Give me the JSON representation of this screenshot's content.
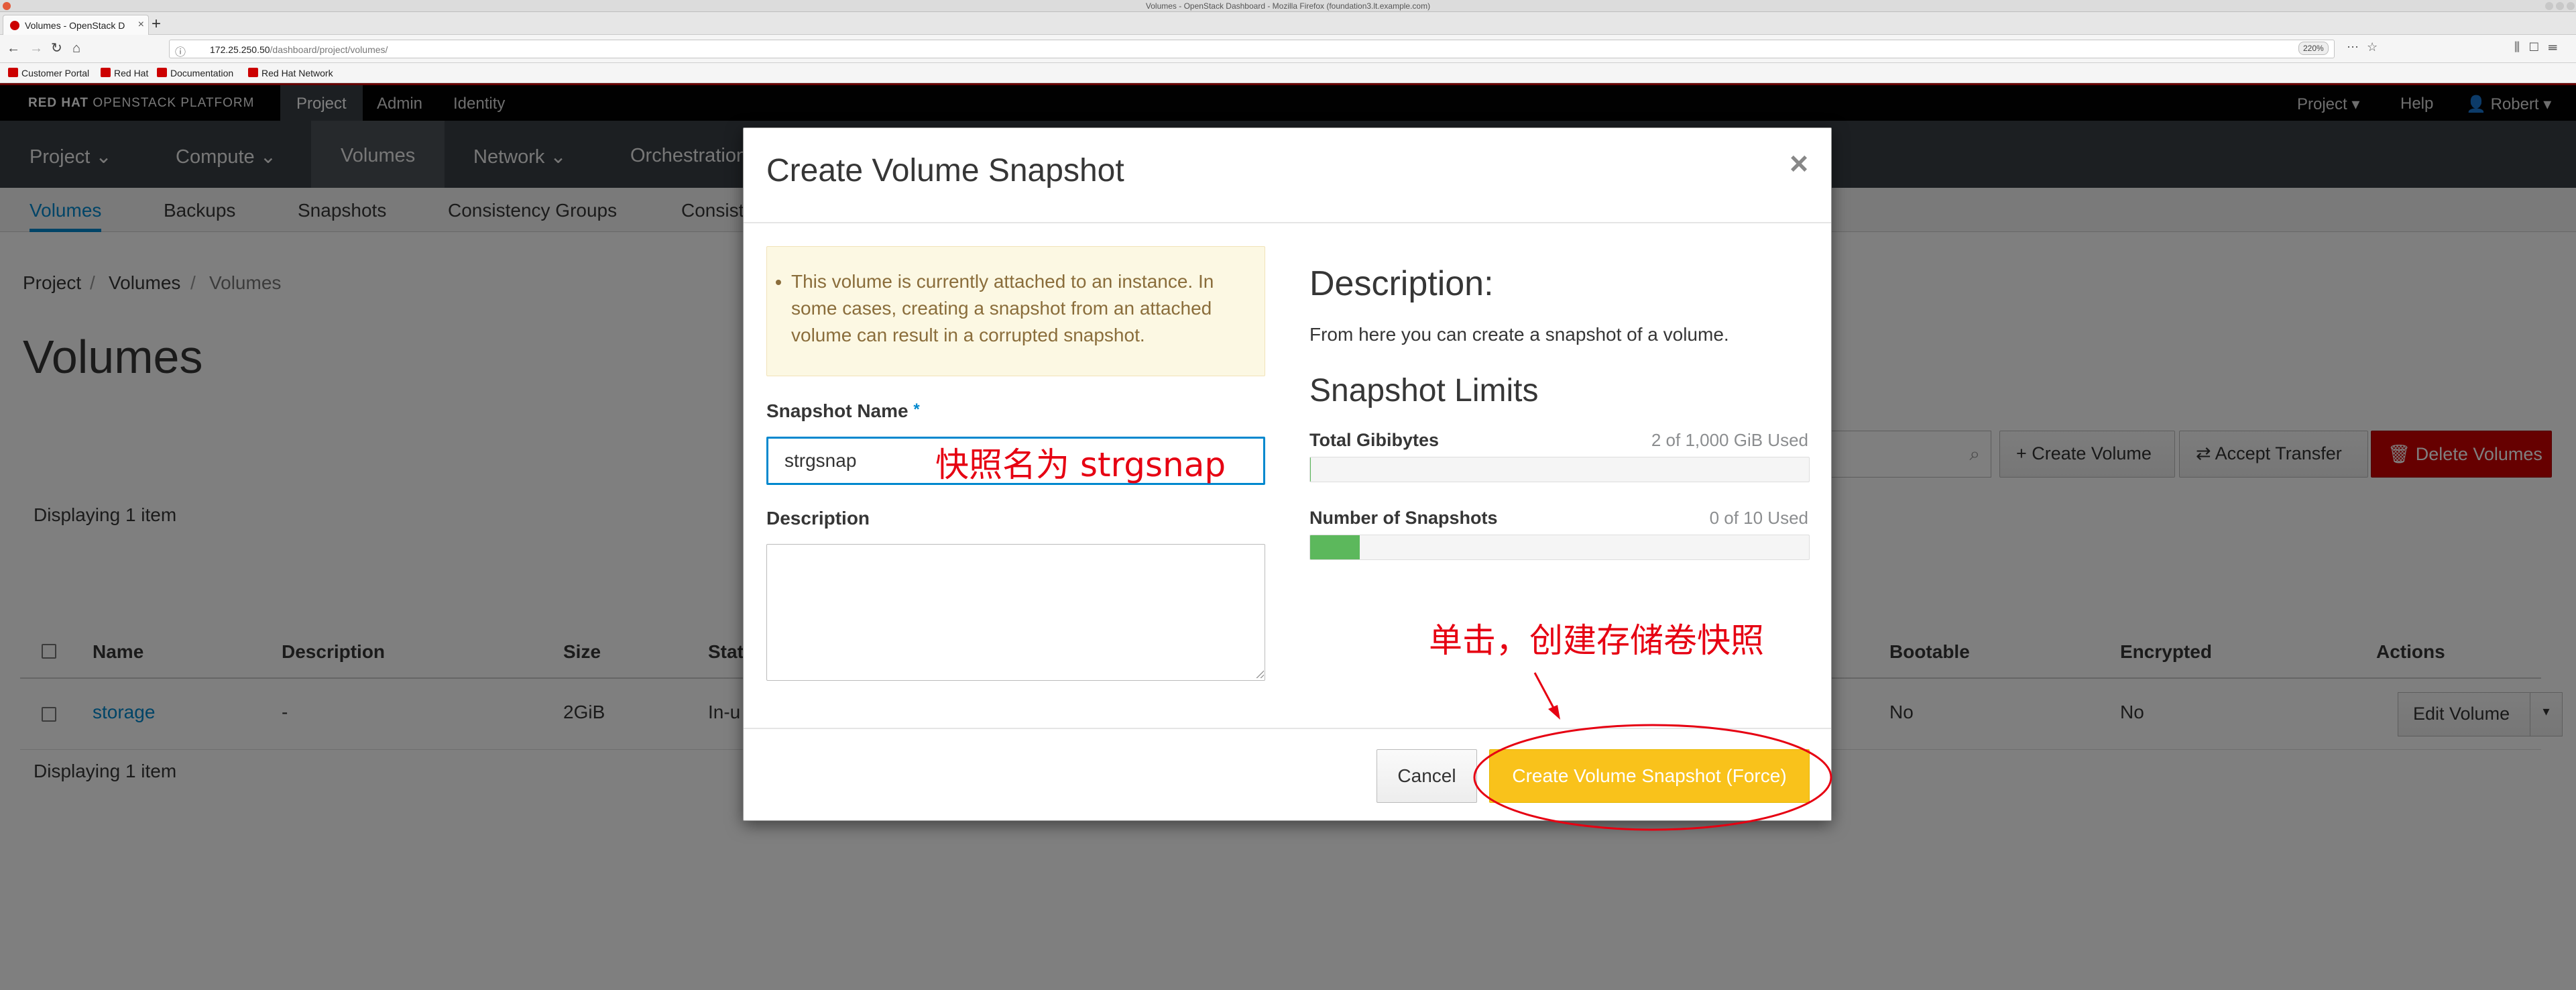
{
  "browser": {
    "window_title": "Volumes - OpenStack Dashboard - Mozilla Firefox (foundation3.lt.example.com)",
    "tab_title": "Volumes - OpenStack D",
    "url_host": "172.25.250.50",
    "url_path": "/dashboard/project/volumes/",
    "zoom": "220%",
    "bookmarks": [
      "Customer Portal",
      "Red Hat",
      "Documentation",
      "Red Hat Network"
    ]
  },
  "topbar": {
    "brand_bold": "RED HAT",
    "brand_rest": " OPENSTACK PLATFORM",
    "nav": [
      "Project",
      "Admin",
      "Identity"
    ],
    "right": {
      "project": "Project",
      "help": "Help",
      "user": "Robert"
    }
  },
  "mainnav": [
    "Project",
    "Compute",
    "Volumes",
    "Network",
    "Orchestration"
  ],
  "subnav": [
    "Volumes",
    "Backups",
    "Snapshots",
    "Consistency Groups",
    "Consist"
  ],
  "breadcrumb": [
    "Project",
    "Volumes",
    "Volumes"
  ],
  "page_title": "Volumes",
  "actions": {
    "create": "Create Volume",
    "accept": "Accept Transfer",
    "delete": "Delete Volumes"
  },
  "table": {
    "count_text": "Displaying 1 item",
    "headers": [
      "Name",
      "Description",
      "Size",
      "Stat",
      "Bootable",
      "Encrypted",
      "Actions"
    ],
    "rows": [
      {
        "name": "storage",
        "description": "-",
        "size": "2GiB",
        "status": "In-u",
        "bootable": "No",
        "encrypted": "No",
        "action": "Edit Volume"
      }
    ]
  },
  "modal": {
    "title": "Create Volume Snapshot",
    "close": "×",
    "warning": "This volume is currently attached to an instance. In some cases, creating a snapshot from an attached volume can result in a corrupted snapshot.",
    "name_label": "Snapshot Name",
    "required_mark": "*",
    "name_value": "strgsnap",
    "desc_label": "Description",
    "right_title": "Description:",
    "right_text": "From here you can create a snapshot of a volume.",
    "limits_title": "Snapshot Limits",
    "limits": [
      {
        "label": "Total Gibibytes",
        "used_text": "2 of 1,000 GiB Used",
        "fraction": 0.002
      },
      {
        "label": "Number of Snapshots",
        "used_text": "0 of 10 Used",
        "fraction": 0.1
      }
    ],
    "cancel": "Cancel",
    "submit": "Create Volume Snapshot (Force)"
  },
  "annotations": {
    "name_note": "快照名为 strgsnap",
    "click_note": "单击，创建存储卷快照",
    "color": "#e60012"
  },
  "colors": {
    "accent": "#0088ce",
    "brand_red": "#cc0000",
    "submit": "#f9c21b",
    "progress": "#5cb85c"
  }
}
